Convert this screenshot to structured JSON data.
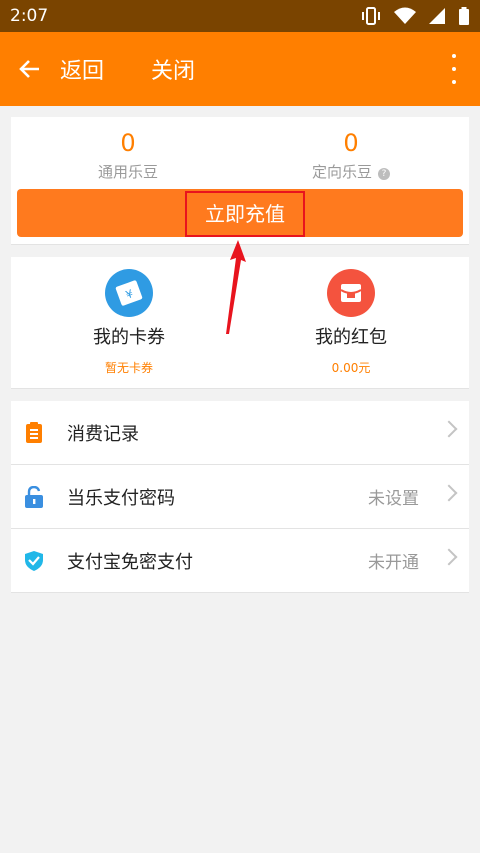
{
  "status_bar": {
    "time": "2:07"
  },
  "app_bar": {
    "back_label": "返回",
    "close_label": "关闭"
  },
  "balance": {
    "general": {
      "value": "0",
      "label": "通用乐豆"
    },
    "directed": {
      "value": "0",
      "label": "定向乐豆"
    },
    "recharge_label": "立即充值"
  },
  "coupons": {
    "cards": {
      "title": "我的卡券",
      "subtitle": "暂无卡券"
    },
    "red_packet": {
      "title": "我的红包",
      "subtitle": "0.00元"
    }
  },
  "menu": [
    {
      "title": "消费记录",
      "value": ""
    },
    {
      "title": "当乐支付密码",
      "value": "未设置"
    },
    {
      "title": "支付宝免密支付",
      "value": "未开通"
    }
  ],
  "colors": {
    "accent": "#ff7f00",
    "status_bar": "#7a4400",
    "recharge_button": "#ff7a1e",
    "annotation_red": "#e8141e"
  }
}
